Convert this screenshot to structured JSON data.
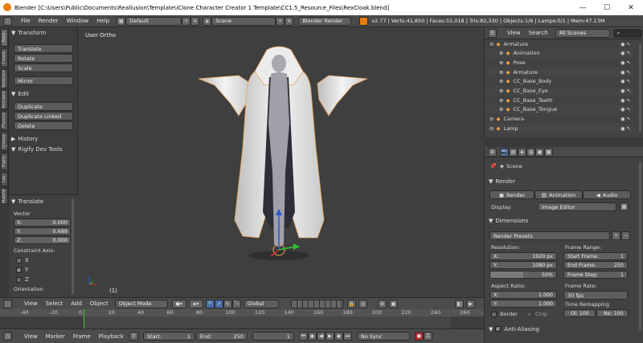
{
  "titlebar": {
    "title": "Blender [C:\\Users\\Public\\Documents\\Reallusion\\Template\\iClone Character Creator 1 Template\\CC1.5_Resource_Files\\RexCloak.blend]",
    "minimize": "—",
    "maximize": "☐",
    "close": "✕"
  },
  "infobar": {
    "menus": [
      "File",
      "Render",
      "Window",
      "Help"
    ],
    "screen_layout": "Default",
    "scene": "Scene",
    "engine": "Blender Render",
    "stats": "v2.77 | Verts:41,850 | Faces:55,018 | Tris:82,330 | Objects:1/6 | Lamps:0/1 | Mem:47.13M"
  },
  "tabs": [
    "Tools",
    "Create",
    "Relations",
    "Animation",
    "Physics",
    "Grease Pencil",
    "Rigify",
    "Lay",
    "MakeWalk"
  ],
  "toolshelf": {
    "transform": {
      "title": "Transform",
      "buttons": [
        "Translate",
        "Rotate",
        "Scale",
        "Mirror"
      ]
    },
    "edit": {
      "title": "Edit",
      "buttons": [
        "Duplicate",
        "Duplicate Linked",
        "Delete"
      ]
    },
    "history": "History",
    "rigify": "Rigify Dev Tools"
  },
  "operator": {
    "title": "Translate",
    "vector_label": "Vector",
    "x": {
      "label": "X:",
      "value": "0.000"
    },
    "y": {
      "label": "Y:",
      "value": "0.689"
    },
    "z": {
      "label": "Z:",
      "value": "0.000"
    },
    "constraint_label": "Constraint Axis:",
    "cx": "X",
    "cy": "Y",
    "cz": "Z",
    "orientation": "Orientation"
  },
  "viewport": {
    "view_name": "User Ortho",
    "frame_indicator": "(1)"
  },
  "vpheader": {
    "menus": [
      "View",
      "Select",
      "Add",
      "Object"
    ],
    "mode": "Object Mode",
    "orientation": "Global"
  },
  "timeline": {
    "ticks": [
      "-40",
      "-20",
      "0",
      "20",
      "40",
      "60",
      "80",
      "100",
      "120",
      "140",
      "160",
      "180",
      "200",
      "220",
      "240",
      "260"
    ],
    "current_frame": 1
  },
  "tlheader": {
    "menus": [
      "View",
      "Marker",
      "Frame",
      "Playback"
    ],
    "start_label": "Start:",
    "start": "1",
    "end_label": "End:",
    "end": "250",
    "current": "1",
    "sync": "No Sync"
  },
  "outliner": {
    "view": "View",
    "search": "Search",
    "filter": "All Scenes",
    "rows": [
      {
        "label": "Armature",
        "indent": 0
      },
      {
        "label": "Animation",
        "indent": 1
      },
      {
        "label": "Pose",
        "indent": 1
      },
      {
        "label": "Armature",
        "indent": 1
      },
      {
        "label": "CC_Base_Body",
        "indent": 1
      },
      {
        "label": "CC_Base_Eye",
        "indent": 1
      },
      {
        "label": "CC_Base_Teeth",
        "indent": 1
      },
      {
        "label": "CC_Base_Tongue",
        "indent": 1
      },
      {
        "label": "Camera",
        "indent": 0
      },
      {
        "label": "Lamp",
        "indent": 0
      }
    ]
  },
  "props": {
    "scene": "Scene",
    "render": {
      "title": "Render",
      "render_btn": "Render",
      "animation_btn": "Animation",
      "audio_btn": "Audio",
      "display_label": "Display:",
      "display": "Image Editor"
    },
    "dimensions": {
      "title": "Dimensions",
      "presets": "Render Presets",
      "resolution": "Resolution:",
      "res_x_label": "X:",
      "res_x": "1920 px",
      "res_y_label": "Y:",
      "res_y": "1080 px",
      "res_pct": "50%",
      "frame_range": "Frame Range:",
      "start_label": "Start Frame:",
      "start": "1",
      "end_label": "End Frame:",
      "end": "250",
      "step_label": "Frame Step:",
      "step": "1",
      "aspect": "Aspect Ratio:",
      "asp_x_label": "X:",
      "asp_x": "1.000",
      "asp_y_label": "Y:",
      "asp_y": "1.000",
      "frame_rate": "Frame Rate:",
      "fps": "30 fps",
      "time_remap": "Time Remapping",
      "ol": "· Ol: 100",
      "ne": "· Ne: 100",
      "border": "Border",
      "crop": "Crop"
    },
    "aa": "Anti-Aliasing"
  }
}
